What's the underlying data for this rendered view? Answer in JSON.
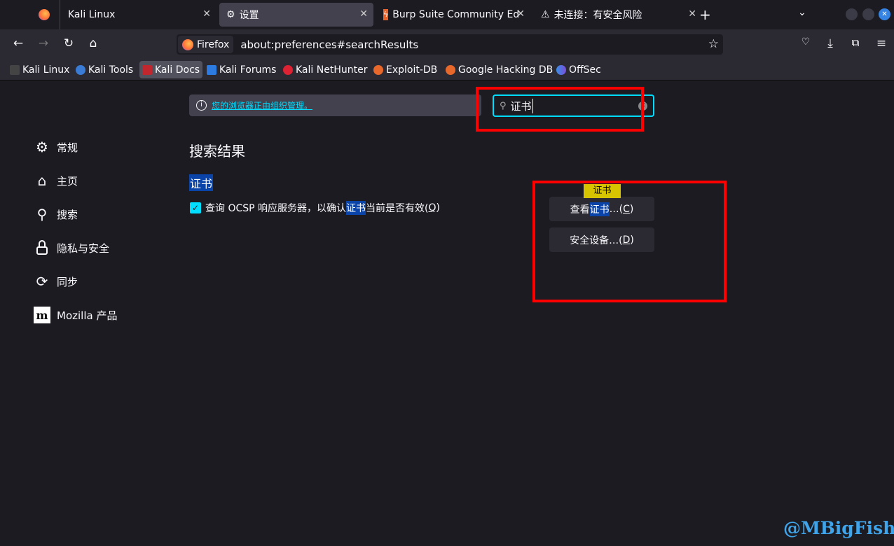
{
  "tabs": [
    {
      "label": "Kali Linux",
      "icon": "firefox-icon"
    },
    {
      "label": "设置",
      "icon": "gear-icon",
      "selected": true
    },
    {
      "label": "Burp Suite Community Ed",
      "icon": "burp-icon"
    },
    {
      "label": "未连接：有安全风险",
      "icon": "warning-icon"
    }
  ],
  "toolbar": {
    "identity": "Firefox",
    "url": "about:preferences#searchResults"
  },
  "bookmarks": [
    {
      "label": "Kali Linux",
      "color": "#222"
    },
    {
      "label": "Kali Tools",
      "color": "#3a7bd5"
    },
    {
      "label": "Kali Docs",
      "color": "#c0262d"
    },
    {
      "label": "Kali Forums",
      "color": "#2d7be0"
    },
    {
      "label": "Kali NetHunter",
      "color": "#d23"
    },
    {
      "label": "Exploit-DB",
      "color": "#e8682b"
    },
    {
      "label": "Google Hacking DB",
      "color": "#e8682b"
    },
    {
      "label": "OffSec",
      "color": "#5a6bd8"
    }
  ],
  "notice": {
    "text": "您的浏览器正由组织管理。"
  },
  "search": {
    "value": "证书"
  },
  "sidebar": {
    "items": [
      {
        "label": "常规",
        "icon": "gear-icon"
      },
      {
        "label": "主页",
        "icon": "home-icon"
      },
      {
        "label": "搜索",
        "icon": "search-icon"
      },
      {
        "label": "隐私与安全",
        "icon": "lock-icon"
      },
      {
        "label": "同步",
        "icon": "sync-icon"
      },
      {
        "label": "Mozilla 产品",
        "icon": "mozilla-icon"
      }
    ]
  },
  "main": {
    "heading": "搜索结果",
    "section_title": "证书",
    "ocsp": {
      "pre": "查询 OCSP 响应服务器，以确认",
      "match": "证书",
      "post": "当前是否有效(",
      "key": "Q",
      "end": ")",
      "checked": true
    },
    "tooltip": "证书",
    "view_cert": {
      "pre": "查看",
      "match": "证书",
      "post": "…(",
      "key": "C",
      "end": ")"
    },
    "security_devices": {
      "pre": "安全设备…(",
      "key": "D",
      "end": ")"
    }
  },
  "watermark": "@MBigFish",
  "colors": {
    "accent": "#00ddff",
    "highlight": "#0a44a8",
    "annotation": "#ff0000",
    "tooltip": "#d7c400"
  }
}
